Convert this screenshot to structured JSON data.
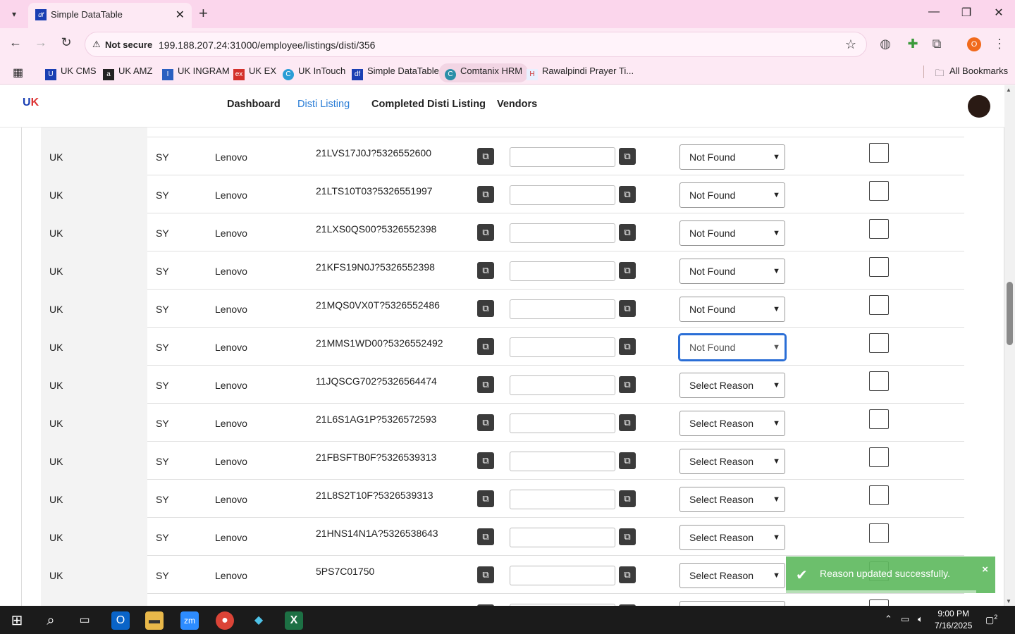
{
  "browser": {
    "tab_title": "Simple DataTable",
    "tab_favicon": "df",
    "url_warning": "Not secure",
    "url": "199.188.207.24:31000/employee/listings/disti/356",
    "profile_initial": "O",
    "bookmarks": [
      {
        "label": "UK CMS",
        "icon": "uk-cms-icon"
      },
      {
        "label": "UK AMZ",
        "icon": "amazon-icon"
      },
      {
        "label": "UK INGRAM",
        "icon": "ingram-icon"
      },
      {
        "label": "UK EX",
        "icon": "ex-icon"
      },
      {
        "label": "UK InTouch",
        "icon": "intouch-icon"
      },
      {
        "label": "Simple DataTable",
        "icon": "datatable-icon"
      },
      {
        "label": "Comtanix HRM",
        "icon": "hrm-icon"
      },
      {
        "label": "Rawalpindi Prayer Ti...",
        "icon": "prayer-icon"
      }
    ],
    "all_bookmarks": "All Bookmarks"
  },
  "nav": {
    "logo_text": "UK",
    "links": [
      "Dashboard",
      "Disti Listing",
      "Completed Disti Listing",
      "Vendors"
    ],
    "active": "Disti Listing"
  },
  "rows": [
    {
      "country": "UK",
      "code": "SY",
      "brand": "Lenovo",
      "sku": "21LVS17J0J?5326552600",
      "reason": "Not Found"
    },
    {
      "country": "UK",
      "code": "SY",
      "brand": "Lenovo",
      "sku": "21LTS10T03?5326551997",
      "reason": "Not Found"
    },
    {
      "country": "UK",
      "code": "SY",
      "brand": "Lenovo",
      "sku": "21LXS0QS00?5326552398",
      "reason": "Not Found"
    },
    {
      "country": "UK",
      "code": "SY",
      "brand": "Lenovo",
      "sku": "21KFS19N0J?5326552398",
      "reason": "Not Found"
    },
    {
      "country": "UK",
      "code": "SY",
      "brand": "Lenovo",
      "sku": "21MQS0VX0T?5326552486",
      "reason": "Not Found"
    },
    {
      "country": "UK",
      "code": "SY",
      "brand": "Lenovo",
      "sku": "21MMS1WD00?5326552492",
      "reason": "Not Found"
    },
    {
      "country": "UK",
      "code": "SY",
      "brand": "Lenovo",
      "sku": "11JQSCG702?5326564474",
      "reason": "Select Reason"
    },
    {
      "country": "UK",
      "code": "SY",
      "brand": "Lenovo",
      "sku": "21L6S1AG1P?5326572593",
      "reason": "Select Reason"
    },
    {
      "country": "UK",
      "code": "SY",
      "brand": "Lenovo",
      "sku": "21FBSFTB0F?5326539313",
      "reason": "Select Reason"
    },
    {
      "country": "UK",
      "code": "SY",
      "brand": "Lenovo",
      "sku": "21L8S2T10F?5326539313",
      "reason": "Select Reason"
    },
    {
      "country": "UK",
      "code": "SY",
      "brand": "Lenovo",
      "sku": "21HNS14N1A?5326538643",
      "reason": "Select Reason"
    },
    {
      "country": "UK",
      "code": "SY",
      "brand": "Lenovo",
      "sku": "5PS7C01750",
      "reason": "Select Reason"
    }
  ],
  "toast": {
    "message": "Reason updated successfully.",
    "color": "#5cb85c"
  },
  "taskbar": {
    "time": "9:00 PM",
    "date": "7/16/2025",
    "notification_count": "2"
  }
}
